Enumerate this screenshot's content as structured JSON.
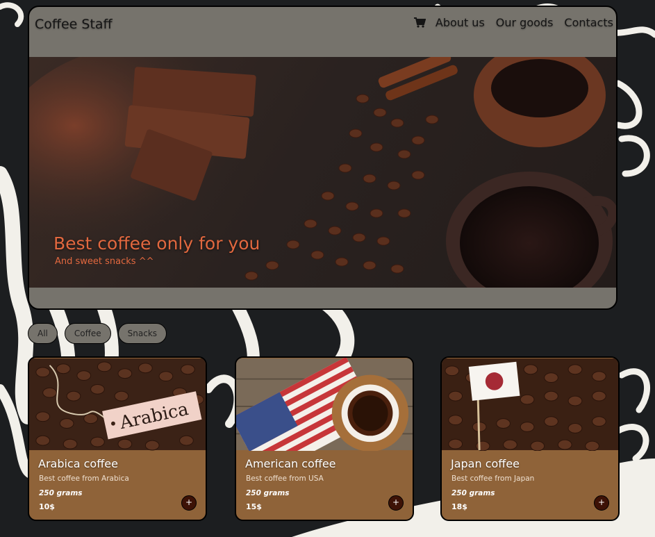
{
  "nav": {
    "brand": "Coffee Staff",
    "links": [
      "About us",
      "Our goods",
      "Contacts"
    ],
    "cart_icon": "shopping-cart-icon"
  },
  "hero": {
    "title": "Best coffee only for you",
    "subtitle": "And sweet snacks ^^"
  },
  "filters": [
    "All",
    "Coffee",
    "Snacks"
  ],
  "products": [
    {
      "title": "Arabica coffee",
      "description": "Best coffee from Arabica",
      "weight": "250 grams",
      "price": "10$",
      "add_label": "+",
      "tag_text": "Arabica"
    },
    {
      "title": "American coffee",
      "description": "Best coffee from USA",
      "weight": "250 grams",
      "price": "15$",
      "add_label": "+"
    },
    {
      "title": "Japan coffee",
      "description": "Best coffee from Japan",
      "weight": "250 grams",
      "price": "18$",
      "add_label": "+"
    }
  ],
  "colors": {
    "background": "#1c1e20",
    "panel": "#76736c",
    "card": "#8f6339",
    "accent": "#e2683f",
    "add_button": "#3d1206"
  }
}
